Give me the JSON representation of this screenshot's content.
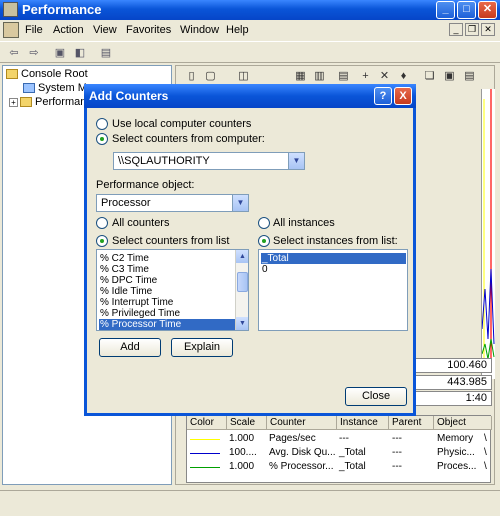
{
  "window": {
    "title": "Performance"
  },
  "menu": [
    "File",
    "Action",
    "View",
    "Favorites",
    "Window",
    "Help"
  ],
  "tree": {
    "root": "Console Root",
    "items": [
      "System Mo",
      "Performan"
    ]
  },
  "stats": {
    "last": "100.460",
    "max": "443.985",
    "duration": "1:40"
  },
  "legend": {
    "headers": [
      "Color",
      "Scale",
      "Counter",
      "Instance",
      "Parent",
      "Object"
    ],
    "rows": [
      {
        "color": "#ffff00",
        "scale": "1.000",
        "counter": "Pages/sec",
        "instance": "---",
        "parent": "---",
        "object": "Memory",
        "extra": "\\"
      },
      {
        "color": "#0000cc",
        "scale": "100....",
        "counter": "Avg. Disk Qu...",
        "instance": "_Total",
        "parent": "---",
        "object": "Physic...",
        "extra": "\\"
      },
      {
        "color": "#00a000",
        "scale": "1.000",
        "counter": "% Processor...",
        "instance": "_Total",
        "parent": "---",
        "object": "Proces...",
        "extra": "\\"
      }
    ]
  },
  "dialog": {
    "title": "Add Counters",
    "help_btn": "?",
    "close_btn": "X",
    "use_local": "Use local computer counters",
    "select_from_computer": "Select counters from computer:",
    "computer_value": "\\\\SQLAUTHORITY",
    "perf_object_label": "Performance object:",
    "perf_object_value": "Processor",
    "all_counters": "All counters",
    "select_counters": "Select counters from list",
    "all_instances": "All instances",
    "select_instances": "Select instances from list:",
    "counters": [
      "% C2 Time",
      "% C3 Time",
      "% DPC Time",
      "% Idle Time",
      "% Interrupt Time",
      "% Privileged Time",
      "% Processor Time"
    ],
    "selected_counter": "% Processor Time",
    "instances": [
      "_Total",
      "0"
    ],
    "selected_instance": "_Total",
    "add_btn": "Add",
    "explain_btn": "Explain",
    "close_label": "Close"
  }
}
